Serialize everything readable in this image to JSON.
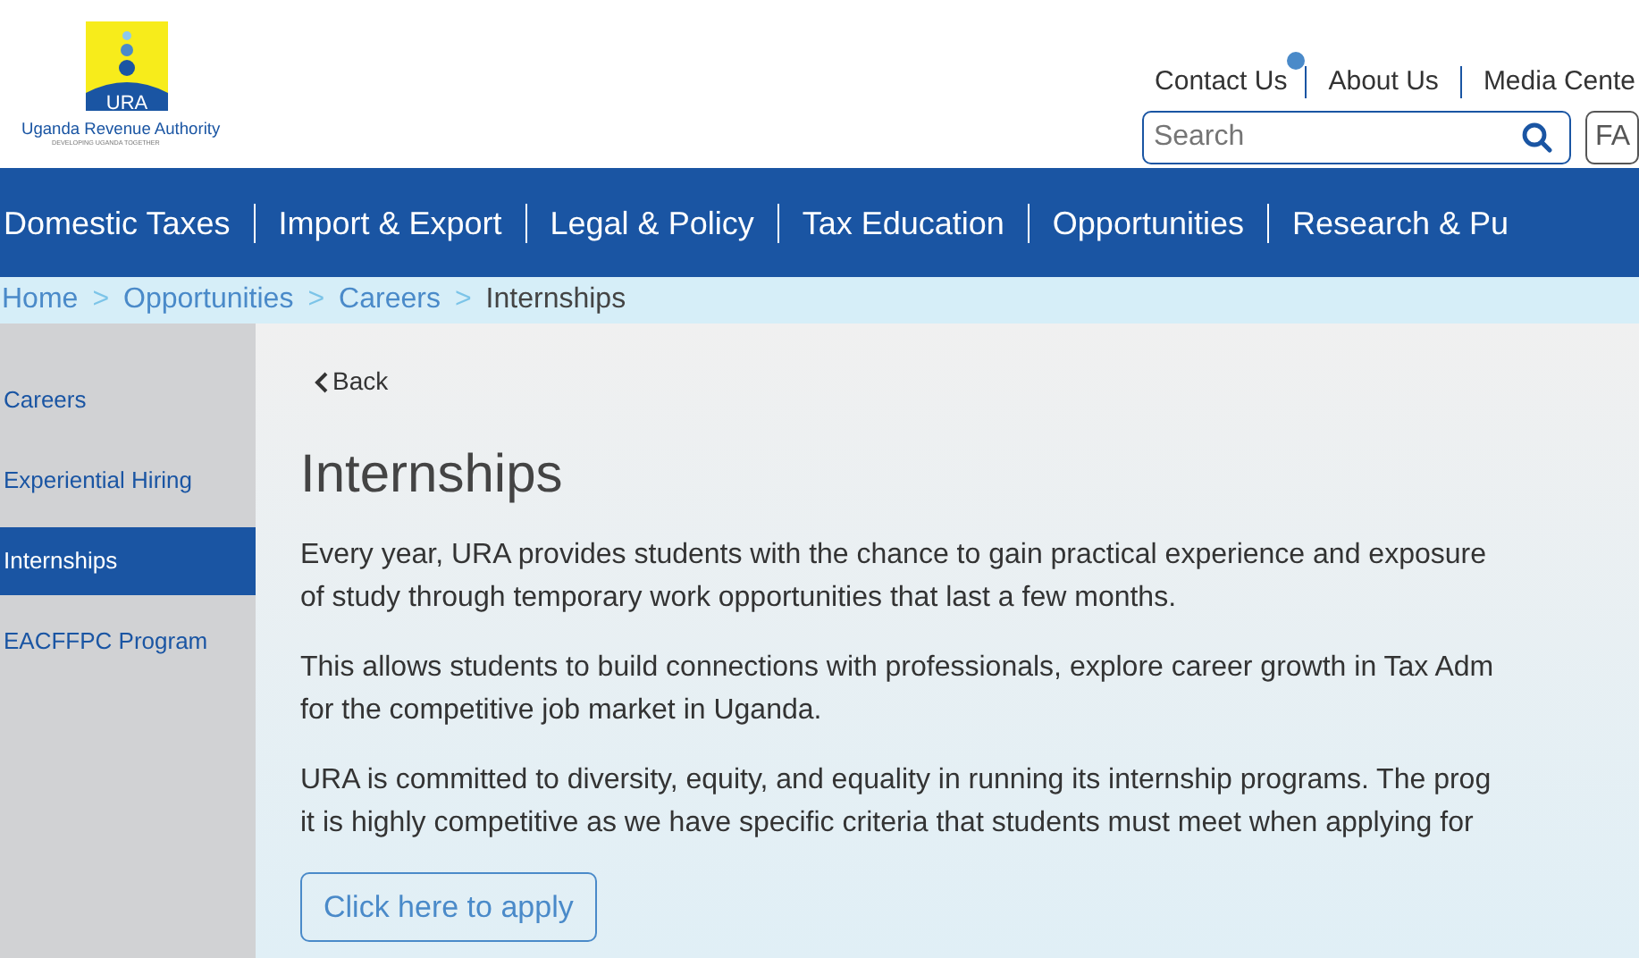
{
  "logo": {
    "mark": "URA",
    "name": "Uganda Revenue Authority",
    "tagline": "DEVELOPING UGANDA TOGETHER"
  },
  "top_links": [
    {
      "label": "Contact Us",
      "notification": true
    },
    {
      "label": "About Us",
      "notification": false
    },
    {
      "label": "Media Cente",
      "notification": false
    }
  ],
  "search": {
    "placeholder": "Search"
  },
  "extra_button": "FA",
  "main_nav": [
    "Domestic Taxes",
    "Import & Export",
    "Legal & Policy",
    "Tax Education",
    "Opportunities",
    "Research & Pu"
  ],
  "breadcrumb": [
    {
      "label": "Home",
      "current": false
    },
    {
      "label": "Opportunities",
      "current": false
    },
    {
      "label": "Careers",
      "current": false
    },
    {
      "label": "Internships",
      "current": true
    }
  ],
  "breadcrumb_separator": ">",
  "sidebar": [
    {
      "label": "Careers",
      "selected": false
    },
    {
      "label": "Experiential Hiring",
      "selected": false
    },
    {
      "label": "Internships",
      "selected": true
    },
    {
      "label": "EACFFPC Program",
      "selected": false
    }
  ],
  "back": "Back",
  "heading": "Internships",
  "paragraphs": [
    {
      "lines": [
        "Every year, URA provides students with the chance to gain practical experience and exposure",
        "of study through temporary work opportunities that last a few months."
      ]
    },
    {
      "lines": [
        "This allows students to build connections with professionals, explore career growth in Tax Adm",
        "for the competitive job market in Uganda."
      ]
    },
    {
      "lines": [
        "URA is committed to diversity, equity, and equality in running its internship programs. The prog",
        "it is highly competitive as we have specific criteria that students must meet when applying for"
      ]
    }
  ],
  "apply_button": "Click here to apply"
}
